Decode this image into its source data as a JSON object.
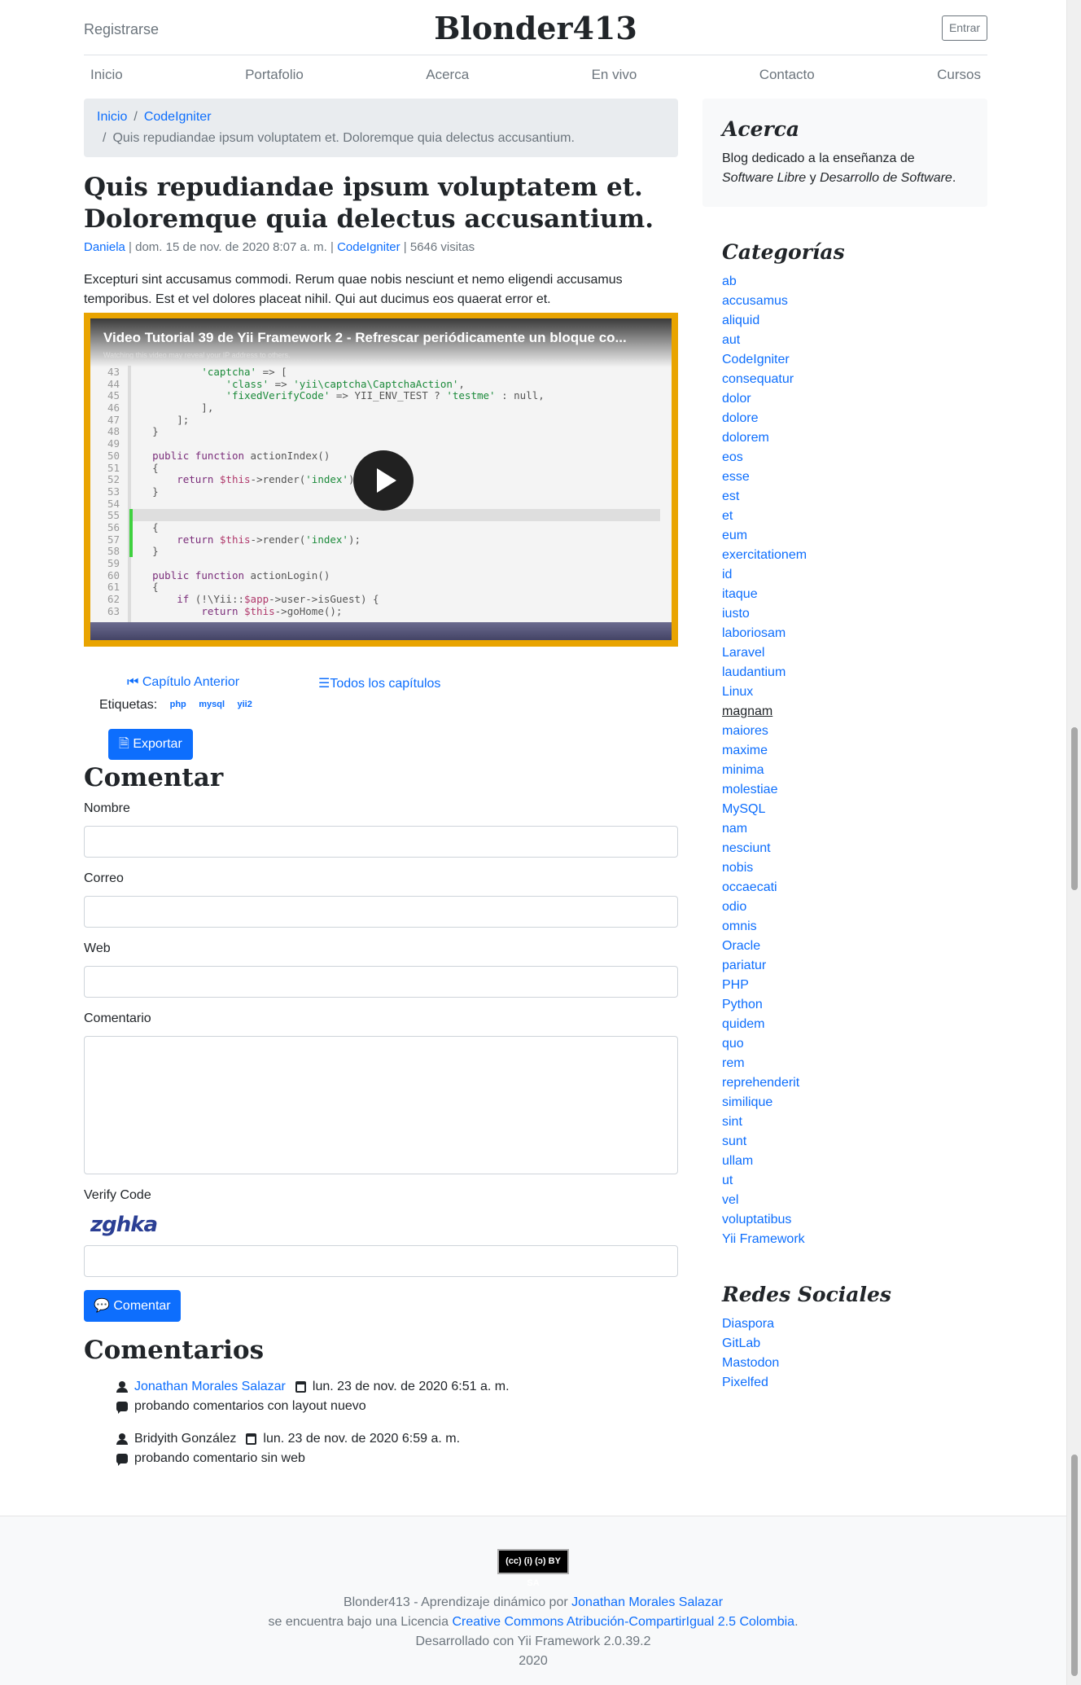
{
  "header": {
    "register": "Registrarse",
    "brand": "Blonder413",
    "login": "Entrar"
  },
  "nav": [
    "Inicio",
    "Portafolio",
    "Acerca",
    "En vivo",
    "Contacto",
    "Cursos"
  ],
  "breadcrumb": {
    "home": "Inicio",
    "category": "CodeIgniter",
    "current": "Quis repudiandae ipsum voluptatem et. Doloremque quia delectus accusantium."
  },
  "post": {
    "title": "Quis repudiandae ipsum voluptatem et. Doloremque quia delectus accusantium.",
    "author": "Daniela",
    "date": "dom. 15 de nov. de 2020 8:07 a. m.",
    "category": "CodeIgniter",
    "visits": "5646 visitas",
    "excerpt": "Excepturi sint accusamus commodi. Rerum quae nobis nesciunt et nemo eligendi accusamus temporibus. Est et vel dolores placeat nihil. Qui aut ducimus eos quaerat error et."
  },
  "video": {
    "title": "Video Tutorial 39 de Yii Framework 2 - Refrescar periódicamente un bloque co...",
    "subtitle": "Watching this video may reveal your IP address to others."
  },
  "chapters": {
    "previous": "Capítulo Anterior",
    "all": "Todos los capítulos"
  },
  "tags": {
    "label": "Etiquetas:",
    "items": [
      "php",
      "mysql",
      "yii2"
    ]
  },
  "export_label": "Exportar",
  "comment_form": {
    "heading": "Comentar",
    "name_label": "Nombre",
    "email_label": "Correo",
    "web_label": "Web",
    "comment_label": "Comentario",
    "verify_label": "Verify Code",
    "captcha": "zghka",
    "submit": "Comentar"
  },
  "comments": {
    "heading": "Comentarios",
    "items": [
      {
        "author": "Jonathan Morales Salazar",
        "date": "lun. 23 de nov. de 2020 6:51 a. m.",
        "text": "probando comentarios con layout nuevo"
      },
      {
        "author": "Bridyith González",
        "date": "lun. 23 de nov. de 2020 6:59 a. m.",
        "text": "probando comentario sin web"
      }
    ]
  },
  "sidebar": {
    "about_heading": "Acerca",
    "about_text_1": "Blog dedicado a la enseñanza de",
    "about_em_1": "Software Libre",
    "about_and": "y",
    "about_em_2": "Desarrollo de Software",
    "categories_heading": "Categorías",
    "categories": [
      "ab",
      "accusamus",
      "aliquid",
      "aut",
      "CodeIgniter",
      "consequatur",
      "dolor",
      "dolore",
      "dolorem",
      "eos",
      "esse",
      "est",
      "et",
      "eum",
      "exercitationem",
      "id",
      "itaque",
      "iusto",
      "laboriosam",
      "Laravel",
      "laudantium",
      "Linux",
      "magnam",
      "maiores",
      "maxime",
      "minima",
      "molestiae",
      "MySQL",
      "nam",
      "nesciunt",
      "nobis",
      "occaecati",
      "odio",
      "omnis",
      "Oracle",
      "pariatur",
      "PHP",
      "Python",
      "quidem",
      "quo",
      "rem",
      "reprehenderit",
      "similique",
      "sint",
      "sunt",
      "ullam",
      "ut",
      "vel",
      "voluptatibus",
      "Yii Framework"
    ],
    "social_heading": "Redes Sociales",
    "social": [
      "Diaspora",
      "GitLab",
      "Mastodon",
      "Pixelfed"
    ]
  },
  "footer": {
    "cc": "BY SA",
    "line1_prefix": "Blonder413 - Aprendizaje dinámico por",
    "line1_link": "Jonathan Morales Salazar",
    "line2_prefix": "se encuentra bajo una Licencia",
    "line2_link": "Creative Commons Atribución-CompartirIgual 2.5 Colombia",
    "line3": "Desarrollado con Yii Framework 2.0.39.2",
    "line4": "2020"
  }
}
